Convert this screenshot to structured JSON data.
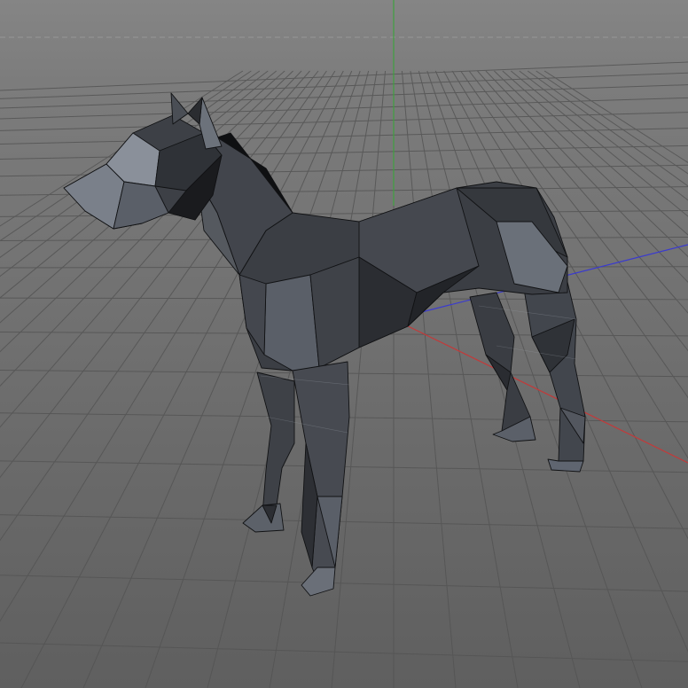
{
  "viewport": {
    "background_top": "#858585",
    "background_bottom": "#5f5f5f",
    "grid_color": "#545454",
    "grid_minor_color": "#7a7a7a",
    "axis_x_color": "#c23a3a",
    "axis_y_color": "#3fa03f",
    "axis_z_color": "#3a3ad0",
    "horizon_color": "#a0a0a0"
  },
  "model": {
    "name": "low-poly-dog",
    "fill": "#3d4046",
    "fill_dark": "#24262a",
    "fill_light": "#6d737c",
    "edge": "#111214"
  }
}
